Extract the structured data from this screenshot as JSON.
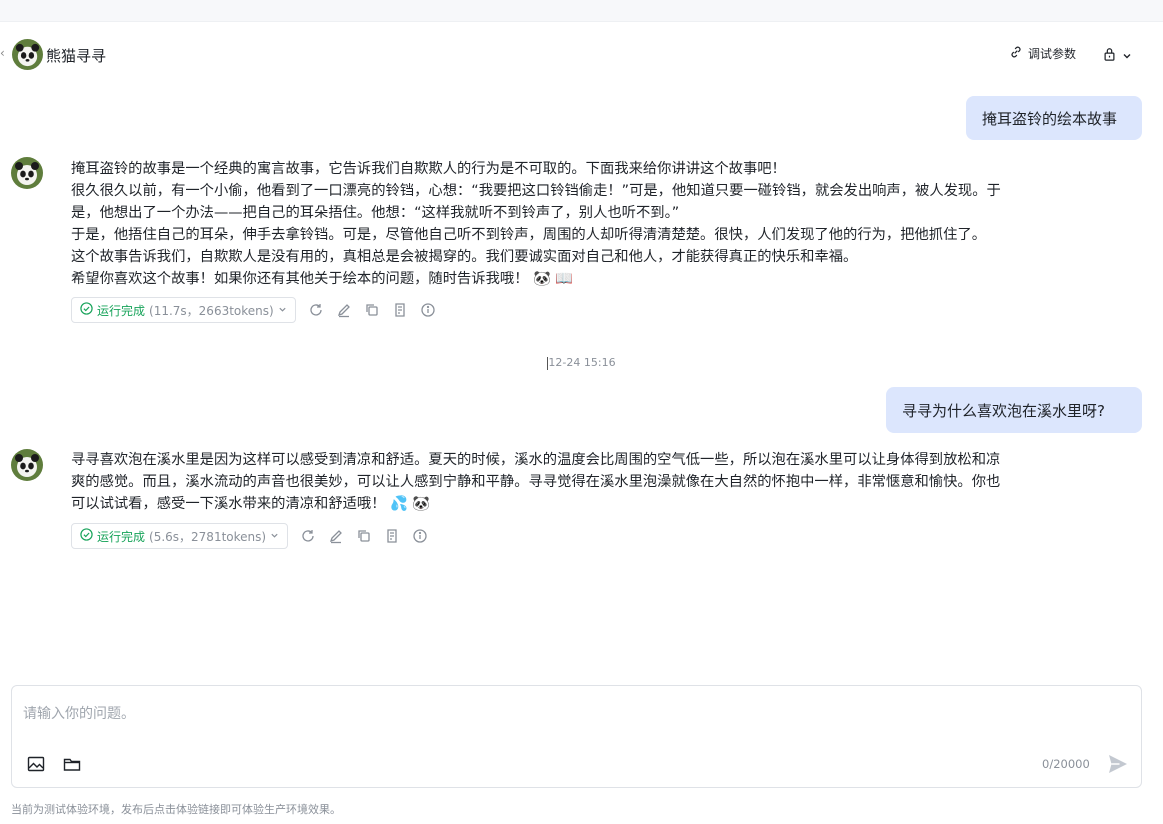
{
  "header": {
    "bot_name": "熊猫寻寻",
    "debug_label": "调试参数"
  },
  "messages": [
    {
      "role": "user",
      "text": "掩耳盗铃的绘本故事"
    },
    {
      "role": "bot",
      "lines": [
        "掩耳盗铃的故事是一个经典的寓言故事，它告诉我们自欺欺人的行为是不可取的。下面我来给你讲讲这个故事吧！",
        "很久很久以前，有一个小偷，他看到了一口漂亮的铃铛，心想：“我要把这口铃铛偷走！”可是，他知道只要一碰铃铛，就会发出响声，被人发现。于",
        "是，他想出了一个办法——把自己的耳朵捂住。他想：“这样我就听不到铃声了，别人也听不到。”",
        "于是，他捂住自己的耳朵，伸手去拿铃铛。可是，尽管他自己听不到铃声，周围的人却听得清清楚楚。很快，人们发现了他的行为，把他抓住了。",
        "这个故事告诉我们，自欺欺人是没有用的，真相总是会被揭穿的。我们要诚实面对自己和他人，才能获得真正的快乐和幸福。",
        "希望你喜欢这个故事！如果你还有其他关于绘本的问题，随时告诉我哦！ 🐼 📖"
      ],
      "status": "运行完成",
      "meta": "(11.7s，2663tokens)"
    },
    {
      "role": "timestamp",
      "text": "12-24 15:16"
    },
    {
      "role": "user",
      "text": "寻寻为什么喜欢泡在溪水里呀?"
    },
    {
      "role": "bot",
      "lines": [
        "寻寻喜欢泡在溪水里是因为这样可以感受到清凉和舒适。夏天的时候，溪水的温度会比周围的空气低一些，所以泡在溪水里可以让身体得到放松和凉",
        "爽的感觉。而且，溪水流动的声音也很美妙，可以让人感到宁静和平静。寻寻觉得在溪水里泡澡就像在大自然的怀抱中一样，非常惬意和愉快。你也",
        "可以试试看，感受一下溪水带来的清凉和舒适哦！ 💦 🐼"
      ],
      "status": "运行完成",
      "meta": "(5.6s，2781tokens)"
    }
  ],
  "input": {
    "placeholder": "请输入你的问题。",
    "value": "",
    "counter": "0/20000"
  },
  "footer": {
    "note": "当前为测试体验环境，发布后点击体验链接即可体验生产环境效果。"
  },
  "colors": {
    "user_bubble": "#dce6fd",
    "status_green": "#17a35a",
    "muted": "#8a9099"
  },
  "icons": [
    "panda-avatar-icon",
    "link-icon",
    "lock-icon",
    "chevron-down-icon",
    "check-circle-icon",
    "refresh-icon",
    "edit-icon",
    "copy-icon",
    "document-icon",
    "info-icon",
    "image-icon",
    "folder-icon",
    "send-icon"
  ]
}
